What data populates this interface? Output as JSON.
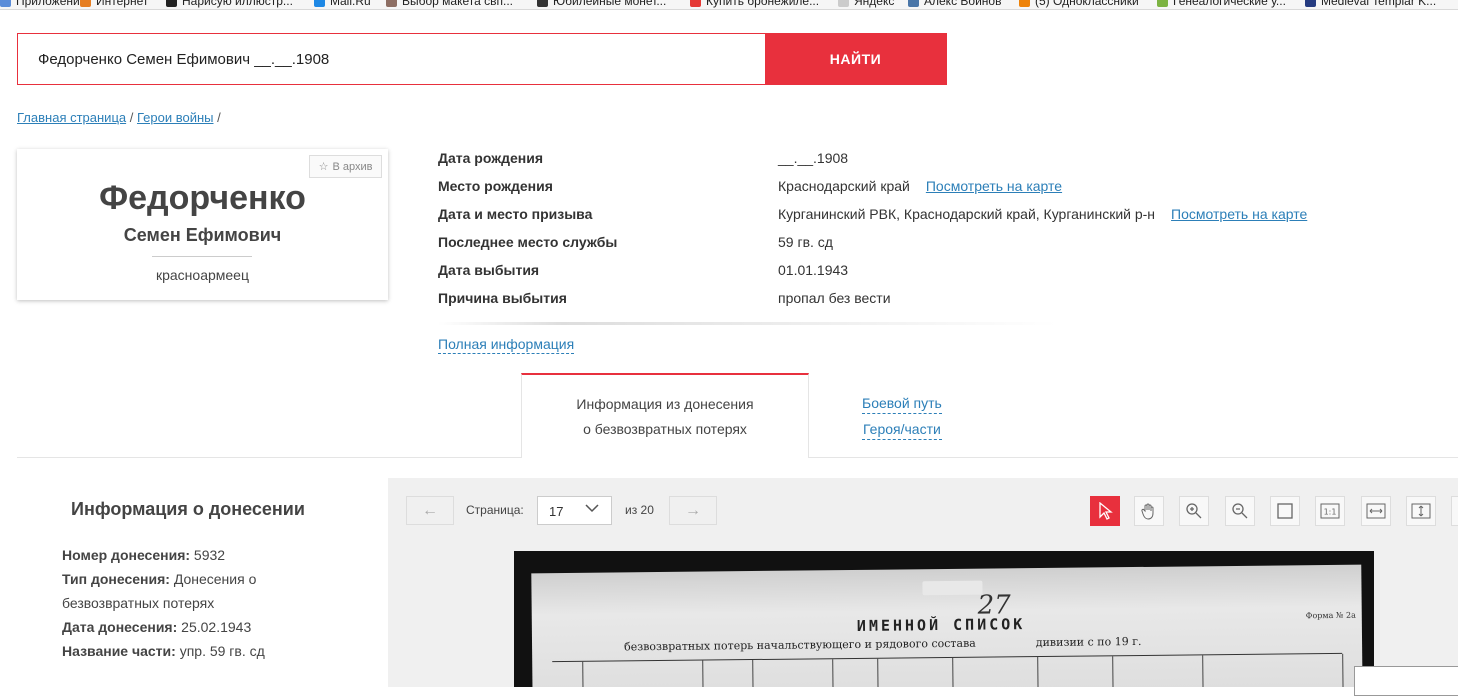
{
  "bookmarks": [
    {
      "label": "Приложения",
      "icon": "apps-icon",
      "color": "#5b8dd9"
    },
    {
      "label": "Интернет",
      "icon": "firefox-icon",
      "color": "#e67e22"
    },
    {
      "label": "Нарисую иллюстр...",
      "icon": "k-letter-icon",
      "color": "#222222"
    },
    {
      "label": "Mail.Ru",
      "icon": "mailru-icon",
      "color": "#1e88e5"
    },
    {
      "label": "Выбор макета свп...",
      "icon": "bookmark-icon",
      "color": "#8d6e63"
    },
    {
      "label": "Юбилейные монет...",
      "icon": "coin-icon",
      "color": "#333333"
    },
    {
      "label": "Купить бронежиле...",
      "icon": "shield-icon",
      "color": "#e53935"
    },
    {
      "label": "Яндекс",
      "icon": "page-icon",
      "color": "#cccccc"
    },
    {
      "label": "Алекс Войнов",
      "icon": "vk-icon",
      "color": "#4a76a8"
    },
    {
      "label": "(5) Одноклассники",
      "icon": "ok-icon",
      "color": "#ee8208"
    },
    {
      "label": "Генеалогические у...",
      "icon": "tree-icon",
      "color": "#7cb342"
    },
    {
      "label": "Medieval Templar K...",
      "icon": "paypal-icon",
      "color": "#253b80"
    }
  ],
  "search": {
    "value": "Федорченко Семен Ефимович __.__.1908",
    "button_label": "НАЙТИ"
  },
  "breadcrumb": {
    "home": "Главная страница",
    "section": "Герои войны",
    "sep": "/"
  },
  "person": {
    "surname": "Федорченко",
    "given_names": "Семен Ефимович",
    "rank": "красноармеец",
    "archive_label": "В архив"
  },
  "details": [
    {
      "label": "Дата рождения",
      "value": "__.__.1908",
      "map": ""
    },
    {
      "label": "Место рождения",
      "value": "Краснодарский край",
      "map": "Посмотреть на карте"
    },
    {
      "label": "Дата и место призыва",
      "value": "Курганинский РВК, Краснодарский край, Курганинский р-н",
      "map": "Посмотреть на карте"
    },
    {
      "label": "Последнее место службы",
      "value": "59 гв. сд",
      "map": ""
    },
    {
      "label": "Дата выбытия",
      "value": "01.01.1943",
      "map": ""
    },
    {
      "label": "Причина выбытия",
      "value": "пропал без вести",
      "map": ""
    }
  ],
  "full_info_link": "Полная информация",
  "tabs": {
    "active_line1": "Информация из донесения",
    "active_line2": "о безвозвратных потерях",
    "other_line1": "Боевой путь",
    "other_line2": "Героя/части"
  },
  "report": {
    "title": "Информация о донесении",
    "number_label": "Номер донесения:",
    "number": "5932",
    "type_label": "Тип донесения:",
    "type": "Донесения о безвозвратных потерях",
    "date_label": "Дата донесения:",
    "date": "25.02.1943",
    "unit_label": "Название части:",
    "unit": "упр. 59 гв. сд"
  },
  "viewer": {
    "prev": "←",
    "next": "→",
    "page_label": "Страница:",
    "page": "17",
    "of_label": "из 20",
    "tools": [
      "pointer-icon",
      "hand-icon",
      "zoom-in-icon",
      "zoom-out-icon",
      "frame-icon",
      "actual-size-icon",
      "fit-width-icon",
      "fit-height-icon"
    ],
    "accent": "#e8303d"
  },
  "document": {
    "handwritten_number": "27",
    "heading": "ИМЕННОЙ СПИСОК",
    "subheading": "безвозвратных потерь начальствующего и рядового состава",
    "division": "дивизии с        по        19     г.",
    "form": "Форма № 2а"
  }
}
